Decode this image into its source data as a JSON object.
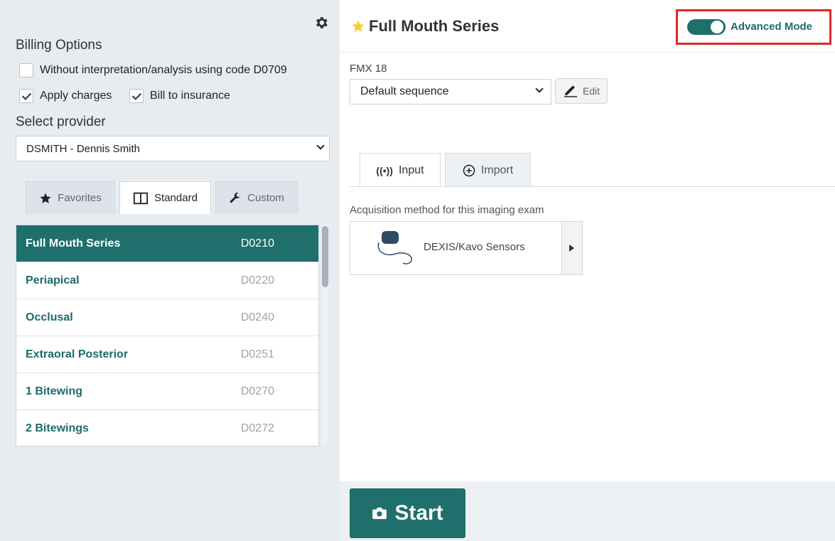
{
  "billing": {
    "title": "Billing Options",
    "without_interpretation": "Without interpretation/analysis using code D0709",
    "apply_charges": "Apply charges",
    "bill_to_insurance": "Bill to insurance"
  },
  "provider": {
    "label": "Select provider",
    "selected": "DSMITH - Dennis Smith"
  },
  "left_tabs": {
    "favorites": "Favorites",
    "standard": "Standard",
    "custom": "Custom"
  },
  "exams": [
    {
      "name": "Full Mouth Series",
      "code": "D0210"
    },
    {
      "name": "Periapical",
      "code": "D0220"
    },
    {
      "name": "Occlusal",
      "code": "D0240"
    },
    {
      "name": "Extraoral Posterior",
      "code": "D0251"
    },
    {
      "name": "1 Bitewing",
      "code": "D0270"
    },
    {
      "name": "2 Bitewings",
      "code": "D0272"
    }
  ],
  "header": {
    "title": "Full Mouth Series",
    "advanced_mode": "Advanced Mode"
  },
  "sequence": {
    "label": "FMX 18",
    "selected": "Default sequence",
    "edit": "Edit"
  },
  "right_tabs": {
    "input": "Input",
    "import": "Import"
  },
  "acquisition": {
    "label": "Acquisition method for this imaging exam",
    "device": "DEXIS/Kavo Sensors"
  },
  "start": "Start",
  "colors": {
    "teal": "#1f6f6c",
    "highlight_border": "#e0262a",
    "star": "#f2cf2f"
  }
}
